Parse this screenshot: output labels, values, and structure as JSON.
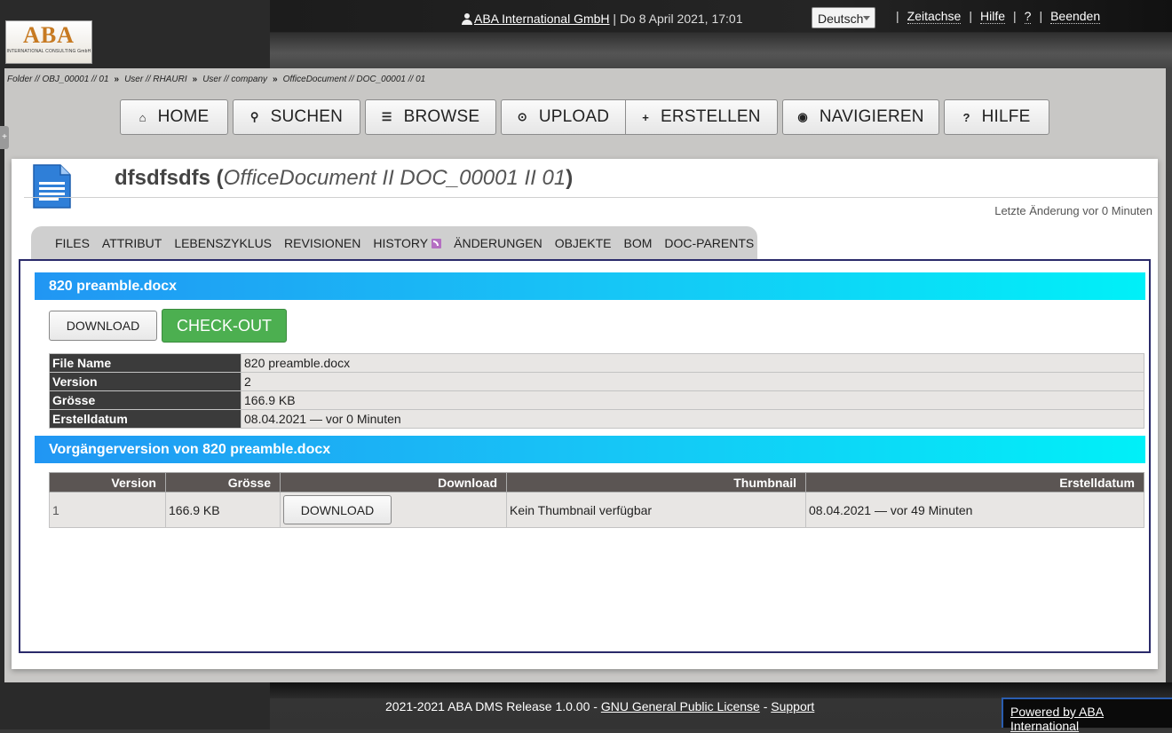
{
  "topbar": {
    "company": "ABA International GmbH",
    "datetime": "| Do 8 April 2021, 17:01",
    "language": "Deutsch",
    "links": [
      "Zeitachse",
      "Hilfe",
      "?",
      "Beenden"
    ],
    "separator": "|"
  },
  "logo": {
    "text": "ABA",
    "subtitle": "INTERNATIONAL CONSULTING GmbH"
  },
  "breadcrumb": [
    "Folder // OBJ_00001 // 01",
    "User // RHAURI",
    "User // company",
    "OfficeDocument // DOC_00001 // 01"
  ],
  "breadcrumb_sep": "»",
  "nav": [
    {
      "label": "HOME",
      "icon": "⌂"
    },
    {
      "label": "SUCHEN",
      "icon": "🔍"
    },
    {
      "label": "BROWSE",
      "icon": "☰"
    },
    {
      "label": "UPLOAD",
      "icon": "⊙"
    },
    {
      "label": "ERSTELLEN",
      "icon": "+"
    },
    {
      "label": "NAVIGIEREN",
      "icon": "◉"
    },
    {
      "label": "HILFE",
      "icon": "?"
    }
  ],
  "document": {
    "name": "dfsdfsdfs",
    "open": "(",
    "subtitle": "OfficeDocument II DOC_00001 II  01",
    "close": ")",
    "last_change": "Letzte Änderung vor 0 Minuten"
  },
  "tabs": [
    "FILES",
    "ATTRIBUT",
    "LEBENSZYKLUS",
    "REVISIONEN",
    "HISTORY",
    "ÄNDERUNGEN",
    "OBJEKTE",
    "BOM",
    "DOC-PARENTS"
  ],
  "file": {
    "header": "820 preamble.docx",
    "download_label": "DOWNLOAD",
    "checkout_label": "CHECK-OUT",
    "properties": [
      {
        "key": "File Name",
        "value": "820 preamble.docx"
      },
      {
        "key": "Version",
        "value": "2"
      },
      {
        "key": "Grösse",
        "value": "166.9 KB"
      },
      {
        "key": "Erstelldatum",
        "value": "08.04.2021 — vor 0 Minuten"
      }
    ]
  },
  "previous": {
    "header": "Vorgängerversion von 820 preamble.docx",
    "columns": [
      "Version",
      "Grösse",
      "Download",
      "Thumbnail",
      "Erstelldatum"
    ],
    "rows": [
      {
        "version": "1",
        "size": "166.9 KB",
        "download": "DOWNLOAD",
        "thumbnail": "Kein Thumbnail verfügbar",
        "created": "08.04.2021 — vor 49 Minuten"
      }
    ]
  },
  "footer": {
    "text": "2021-2021 ABA DMS Release 1.0.00 -",
    "license": "GNU General Public License",
    "dash": "-",
    "support": "Support",
    "powered": "Powered by ABA International"
  }
}
